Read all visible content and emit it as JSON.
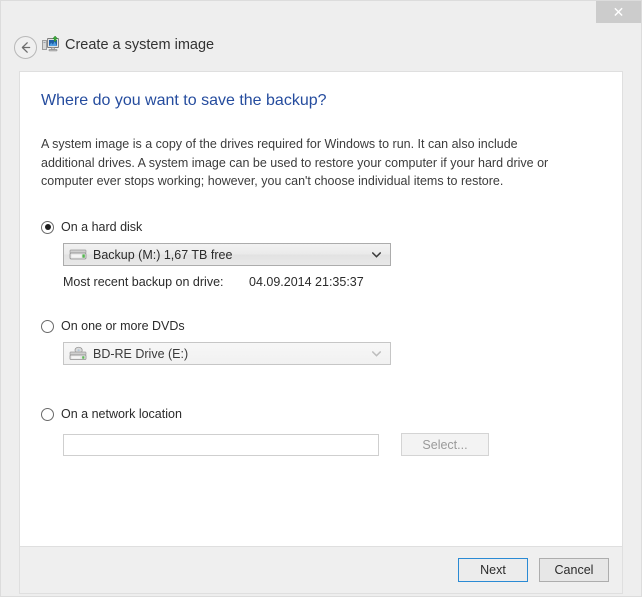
{
  "window": {
    "close_label": "✕"
  },
  "header": {
    "title": "Create a system image",
    "back_icon": "back-arrow-icon",
    "app_icon": "system-image-icon"
  },
  "page": {
    "heading": "Where do you want to save the backup?",
    "description": "A system image is a copy of the drives required for Windows to run. It can also include additional drives. A system image can be used to restore your computer if your hard drive or computer ever stops working; however, you can't choose individual items to restore."
  },
  "options": {
    "hard_disk": {
      "label": "On a hard disk",
      "selected": true,
      "dropdown": {
        "value": "Backup (M:)  1,67 TB free",
        "icon": "hard-drive-icon",
        "enabled": true
      },
      "recent_backup_label": "Most recent backup on drive:",
      "recent_backup_value": "04.09.2014 21:35:37"
    },
    "dvd": {
      "label": "On one or more DVDs",
      "selected": false,
      "dropdown": {
        "value": "BD-RE Drive (E:)",
        "icon": "optical-drive-icon",
        "enabled": false
      }
    },
    "network": {
      "label": "On a network location",
      "selected": false,
      "input_value": "",
      "input_placeholder": "",
      "select_button_label": "Select..."
    }
  },
  "footer": {
    "next_label": "Next",
    "cancel_label": "Cancel"
  },
  "colors": {
    "heading": "#254c9e",
    "focus_border": "#2a8ad4",
    "window_chrome": "#eeeeee"
  }
}
